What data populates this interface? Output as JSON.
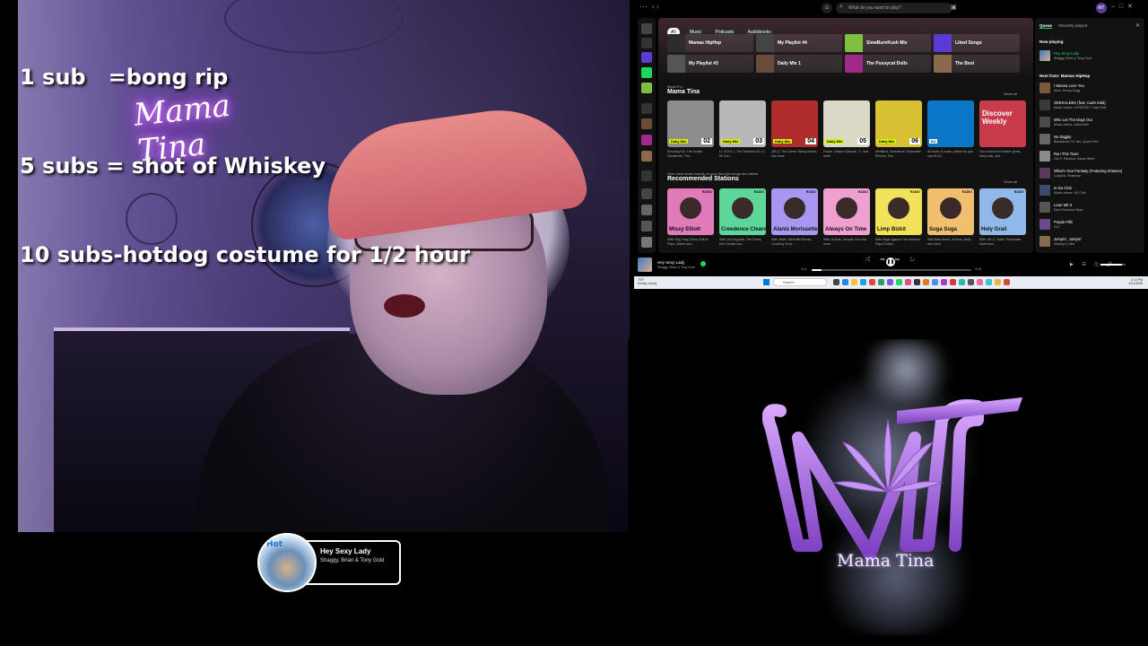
{
  "overlay": {
    "sub_goals": [
      "1 sub   =bong rip",
      "5 subs = shot of Whiskey",
      "10 subs-hotdog costume for 1/2 hour"
    ],
    "neon_sign": "Mama Tina"
  },
  "now_playing_widget": {
    "art_logo": "Hot",
    "title": "Hey Sexy Lady",
    "artist": "Shaggy, Brian & Tony Gold"
  },
  "spotify": {
    "topbar": {
      "search_placeholder": "What do you want to play?",
      "user_initial": "MT"
    },
    "filter_chips": [
      "All",
      "Music",
      "Podcasts",
      "Audiobooks"
    ],
    "quick_picks": [
      {
        "label": "Mamas HipHop",
        "color": "#2c2c2c"
      },
      {
        "label": "My Playlist #4",
        "color": "#444"
      },
      {
        "label": "SlowBurnKush Mix",
        "color": "#7fbf3f"
      },
      {
        "label": "Liked Songs",
        "color": "#5b3bd6"
      },
      {
        "label": "My Playlist #3",
        "color": "#555"
      },
      {
        "label": "Daily Mix 1",
        "color": "#6b4c3b"
      },
      {
        "label": "The Pussycat Dolls",
        "color": "#a02a8a"
      },
      {
        "label": "The Best",
        "color": "#8a6a4a"
      }
    ],
    "made_for": {
      "small": "Made For",
      "title": "Mama Tina",
      "show_all": "Show all",
      "cards": [
        {
          "tag": "Daily Mix",
          "num": "02",
          "desc": "Smoking Kid, The Soulful Gentlemen, Tha...",
          "color": "#8d8d8d"
        },
        {
          "tag": "Daily Mix",
          "num": "03",
          "desc": "LL COOL J, The Notorious B.I.G., 50 Cen...",
          "color": "#b8b8b8"
        },
        {
          "tag": "Daily Mix",
          "num": "04",
          "desc": "JAY-Z, The Game, Nancy Isaacs and more",
          "color": "#b12c2c"
        },
        {
          "tag": "Daily Mix",
          "num": "05",
          "desc": "Future, Unique Episode, T.I. and more",
          "color": "#d9d9c6"
        },
        {
          "tag": "Daily Mix",
          "num": "06",
          "desc": "Metallica, Creedence Clearwater Revival, The...",
          "color": "#d6c232"
        },
        {
          "tag": "DJ",
          "num": "",
          "desc": "All kinds of music, picked by your own AI DJ.",
          "color": "#0a77c9"
        },
        {
          "tag": "Discover Weekly",
          "num": "",
          "desc": "Your shortcut to hidden gems, deep cuts, and...",
          "color": "#c83b4b"
        }
      ]
    },
    "recommended": {
      "small": "Rom vista music based on your favorite songs and artists",
      "title": "Recommended Stations",
      "show_all": "Show all",
      "cards": [
        {
          "name": "Missy Elliott",
          "desc": "With Ying Yang Twins, Salt-N-Pepa, Sweet and...",
          "color": "#e07ab8"
        },
        {
          "name": "Creedence Clearwater Revival",
          "desc": "With Led Zeppelin, The Doors, Den Smoke and...",
          "color": "#5ed69a"
        },
        {
          "name": "Alanis Morissette",
          "desc": "With Jewel, Meredith Brooks, Counting Crow...",
          "color": "#a896f0"
        },
        {
          "name": "Always On Time",
          "desc": "With Ja Rule, Ashanti, Eve and more",
          "color": "#f0a0d0"
        },
        {
          "name": "Limp Bizkit",
          "desc": "With Rage Against The Machine, Papa Roach...",
          "color": "#f2e25a"
        },
        {
          "name": "Suga Suga",
          "desc": "With Baby Bash, Ja Rule, Nelly and more",
          "color": "#f0c070"
        },
        {
          "name": "Holy Grail",
          "desc": "With JAY-Z, Justin Timberlake, North and...",
          "color": "#90b8e8"
        }
      ]
    },
    "queue": {
      "tabs": [
        "Queue",
        "Recently played"
      ],
      "now_playing_label": "Now playing",
      "now_playing": {
        "title": "Hey Sexy Lady",
        "artist": "Shaggy, Brian & Tony Gold"
      },
      "next_label": "Next from: Mamas HipHop",
      "items": [
        {
          "title": "I Wanna Love You",
          "artist": "Akon, Snoop Dogg"
        },
        {
          "title": "GEEKALEEK (feat. Cash Kidd)",
          "artist": "Music videos • OHGEESY, Cash Kidd"
        },
        {
          "title": "Who Let The Dogs Out",
          "artist": "Music videos • Baha Men"
        },
        {
          "title": "No Diggity",
          "artist": "Blackstreet, Dr. Dre, Queen Pen"
        },
        {
          "title": "Run This Town",
          "artist": "JAY-Z, Rihanna, Kanye West"
        },
        {
          "title": "What's Your Fantasy (Featuring Shawna)",
          "artist": "Ludacris, Shawnna"
        },
        {
          "title": "In Da Club",
          "artist": "Music videos • 50 Cent"
        },
        {
          "title": "Lean Wit It",
          "artist": "Dem Franchize Boyz"
        },
        {
          "title": "Purple Pills",
          "artist": "D12"
        },
        {
          "title": "Jumpin', Jumpin'",
          "artist": "Destiny's Child"
        }
      ]
    },
    "player": {
      "title": "Hey Sexy Lady",
      "artist": "Shaggy, Brian & Tony Gold",
      "elapsed": "0:11",
      "duration": "3:18",
      "progress_fraction": 0.06,
      "volume_fraction": 0.85
    },
    "taskbar": {
      "weather": "75°F\nMostly cloudy",
      "search_label": "Search",
      "clock_time": "2:14 PM",
      "clock_date": "4/21/2025"
    }
  },
  "logo": {
    "name": "Mama Tina",
    "monogram": "MT"
  }
}
